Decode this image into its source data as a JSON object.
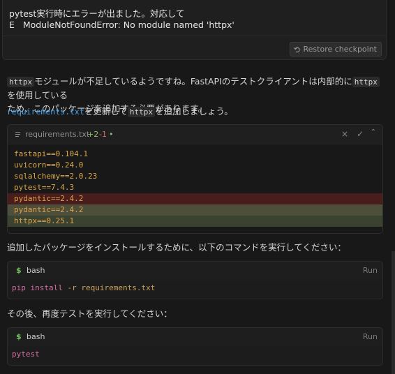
{
  "user_message": {
    "line1": "pytest実行時にエラーが出ました。対応して",
    "line2": "E   ModuleNotFoundError: No module named 'httpx'",
    "restore_label": "Restore checkpoint"
  },
  "assistant": {
    "p1": {
      "code": "httpx",
      "text1": "モジュールが不足しているようですね。FastAPIのテストクライアントは内部的に",
      "code2": "httpx",
      "text2": "を使用している",
      "line2": "ため、このパッケージを追加する必要があります。"
    },
    "p2": {
      "file": "requirements.txt",
      "mid": "を更新して",
      "code": "httpx",
      "end": "を追加しましょう。"
    },
    "p3": "追加したパッケージをインストールするために、以下のコマンドを実行してください：",
    "p4": "その後、再度テストを実行してください："
  },
  "file_edit": {
    "filename": "requirements.txt",
    "added": "+2",
    "removed": "-1",
    "dot": "•",
    "close_icon_glyph": "×",
    "accept_icon_glyph": "✓",
    "expand_icon_glyph": "⌃",
    "lines": [
      {
        "text": "fastapi==0.104.1",
        "kind": "normal"
      },
      {
        "text": "uvicorn==0.24.0",
        "kind": "normal"
      },
      {
        "text": "sqlalchemy==2.0.23",
        "kind": "normal"
      },
      {
        "text": "pytest==7.4.3",
        "kind": "normal"
      },
      {
        "text": "pydantic==2.4.2",
        "kind": "del"
      },
      {
        "text": "pydantic==2.4.2",
        "kind": "add1"
      },
      {
        "text": "httpx==0.25.1",
        "kind": "add2"
      }
    ]
  },
  "bash1": {
    "prompt": "$",
    "lang": "bash",
    "run": "Run",
    "cmd": "pip install",
    "args": " -r requirements.txt"
  },
  "bash2": {
    "prompt": "$",
    "lang": "bash",
    "run": "Run",
    "cmd": "pytest"
  },
  "colors": {
    "background": "#181818",
    "link": "#4ea3e8",
    "deleted_line": "#4a1d1d",
    "added_line": "#4d4f3a",
    "added_line2": "#3a4230",
    "added_count": "#8fbf6a",
    "removed_count": "#d26d6d"
  }
}
